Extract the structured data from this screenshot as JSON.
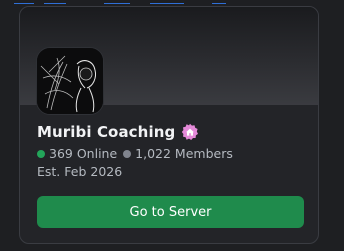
{
  "invite_card": {
    "server_name": "Muribi Coaching",
    "online_count_label": "369 Online",
    "member_count_label": "1,022 Members",
    "established_label": "Est. Feb 2026",
    "button_label": "Go to Server",
    "server_icon": "server-avatar-image",
    "server_badge_icon": "house-badge-icon"
  },
  "colors": {
    "background": "#1e1f22",
    "card": "#232428",
    "online_dot": "#23a55a",
    "members_dot": "#80848e",
    "button": "#1f8b4c",
    "badge": "#e48ad9"
  }
}
